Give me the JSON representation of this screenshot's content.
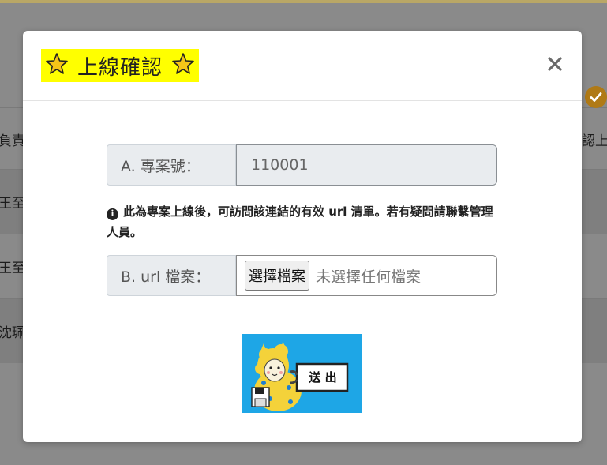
{
  "background": {
    "header_left": "負責",
    "header_right": "認上",
    "rows": [
      {
        "left": "王至"
      },
      {
        "left": "王至"
      },
      {
        "left": "沈珮"
      }
    ]
  },
  "modal": {
    "title": "上線確認",
    "title_star_icon": "star-icon",
    "close_label": "×",
    "project_label": "A. 專案號：",
    "project_value": "110001",
    "note": "此為專案上線後，可訪問該連結的有效 url 清單。若有疑問請聯繫管理人員。",
    "url_label": "B. url 檔案：",
    "file_button": "選擇檔案",
    "file_status": "未選擇任何檔案",
    "submit_label": "送 出"
  },
  "colors": {
    "title_highlight": "#ffff00",
    "submit_bg": "#1ea6e6",
    "check_badge": "#b07a16"
  }
}
